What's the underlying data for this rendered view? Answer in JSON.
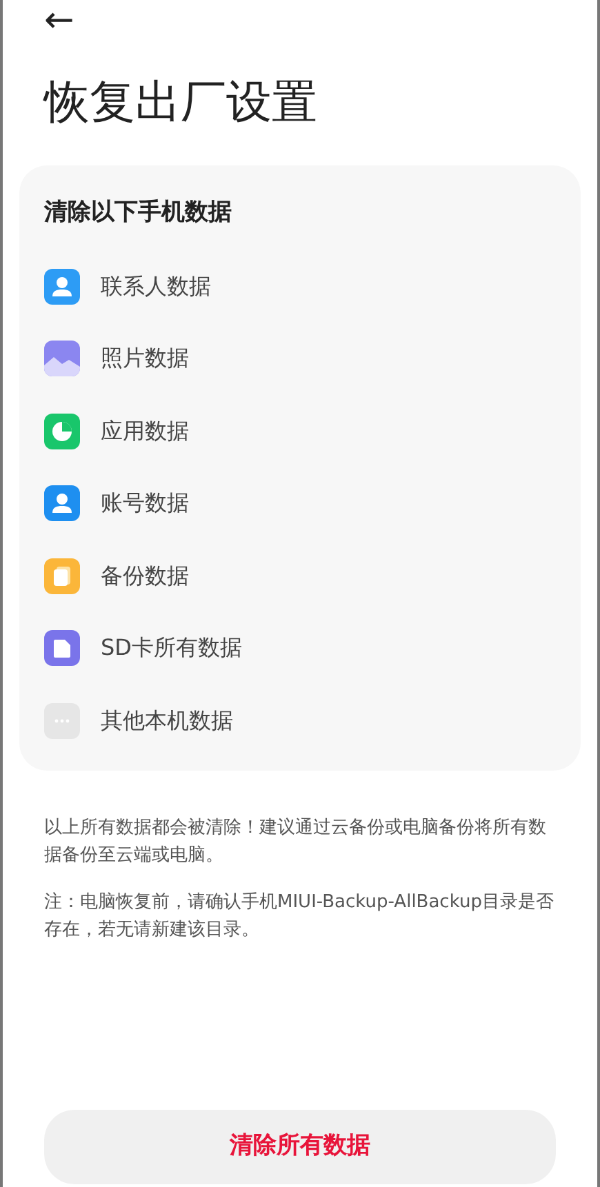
{
  "header": {
    "back": "←",
    "title": "恢复出厂设置"
  },
  "card": {
    "title": "清除以下手机数据",
    "items": [
      {
        "kind": "contacts",
        "label": "联系人数据"
      },
      {
        "kind": "photos",
        "label": "照片数据"
      },
      {
        "kind": "apps",
        "label": "应用数据"
      },
      {
        "kind": "account",
        "label": "账号数据"
      },
      {
        "kind": "backup",
        "label": "备份数据"
      },
      {
        "kind": "sd",
        "label": "SD卡所有数据"
      },
      {
        "kind": "other",
        "label": "其他本机数据"
      }
    ]
  },
  "notes": [
    "以上所有数据都会被清除！建议通过云备份或电脑备份将所有数据备份至云端或电脑。",
    "注：电脑恢复前，请确认手机MIUI-Backup-AllBackup目录是否存在，若无请新建该目录。"
  ],
  "button": "清除所有数据"
}
